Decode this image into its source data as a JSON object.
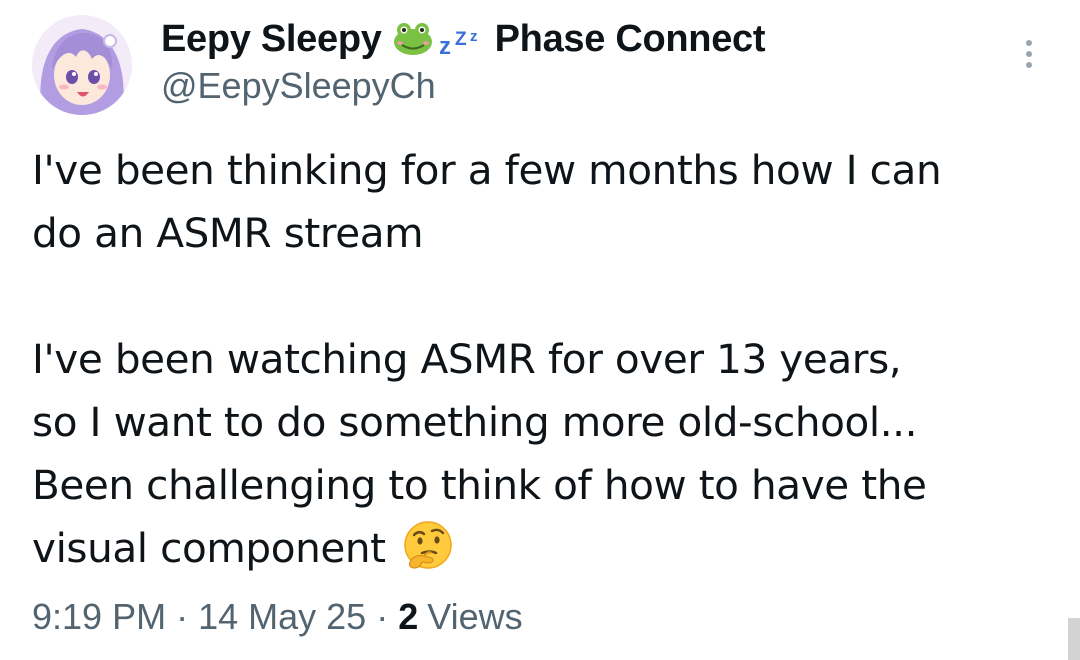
{
  "tweet": {
    "author": {
      "display_name": "Eepy Sleepy",
      "name_suffix": "Phase Connect",
      "handle": "@EepySleepyCh",
      "badge_icons": [
        "frog-face-icon",
        "zzz-icon"
      ]
    },
    "text": {
      "paragraph_1": {
        "line_1": "I've been thinking for a few months how I can",
        "line_2": "do an ASMR stream"
      },
      "paragraph_2": {
        "line_1": "I've been watching ASMR for over 13 years,",
        "line_2": "so I want to do something more old-school...",
        "line_3": "Been challenging to think of how to have the",
        "line_4": "visual component",
        "trailing_emoji": "thinking-face-icon"
      }
    },
    "meta": {
      "time": "9:19 PM",
      "separator": "·",
      "date": "14 May 25",
      "views_count": "2",
      "views_label": "Views"
    }
  },
  "colors": {
    "text_primary": "#0f1419",
    "text_secondary": "#536471",
    "avatar_bg": "#f3ebf7",
    "avatar_hair": "#a58ed8",
    "frog_green": "#7bc144",
    "zzz_blue": "#3b6fd9",
    "emoji_yellow": "#ffcb3d"
  }
}
